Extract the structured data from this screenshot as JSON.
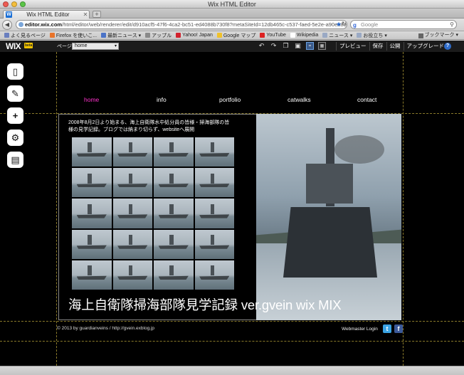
{
  "window": {
    "title": "Wix HTML Editor",
    "traffic_colors": [
      "#ee5b52",
      "#f4be3c",
      "#5bc548"
    ]
  },
  "tabs": [
    {
      "label": "Wix HTML Editor",
      "favicon": "wix-favicon"
    }
  ],
  "newtab_label": "+",
  "nav": {
    "url_host": "editor.wix.com",
    "url_path": "/html/editor/web/renderer/edit/d910acf5-47f6-4ca2-bc51-ed4088b730f8?metaSiteId=12db465c-c537-faed-5e2e-a90ee8931",
    "search_placeholder": "Google",
    "back_symbol": "◀",
    "star_symbol": "★",
    "refresh_symbol": "↻",
    "search_symbol": "⚲",
    "search_g": "g"
  },
  "bookmarks": [
    {
      "label": "よく見るページ",
      "icon_color": "#6a7fbf"
    },
    {
      "label": "Firefox を使いこ...",
      "icon_color": "#e8742a"
    },
    {
      "label": "最新ニュース ▾",
      "icon_color": "#4b73c7"
    },
    {
      "label": "アップル",
      "icon_color": "#8a8a8a"
    },
    {
      "label": "Yahoo! Japan",
      "icon_color": "#d2212d"
    },
    {
      "label": "Google マップ",
      "icon_color": "#f0c12b"
    },
    {
      "label": "YouTube",
      "icon_color": "#d22"
    },
    {
      "label": "Wikipedia",
      "icon_color": "#fff"
    },
    {
      "label": "ニュース ▾",
      "icon_color": "#9aa9c4"
    },
    {
      "label": "お役立ち ▾",
      "icon_color": "#9aa9c4"
    }
  ],
  "bookmarks_menu": "ブックマーク ▾",
  "wix_bar": {
    "logo": "WIX",
    "beta": "beta",
    "page_label": "ページ:",
    "page_value": "home",
    "caret": "▾",
    "tools": [
      "↶",
      "↷",
      "❐",
      "▣",
      "⌗",
      "▦"
    ],
    "menu": [
      "プレビュー",
      "保存",
      "公開",
      "アップグレード"
    ],
    "help": "?",
    "accent": "#2e6bc9"
  },
  "side_tools": [
    {
      "name": "pages-icon",
      "glyph": "▯"
    },
    {
      "name": "design-brush-icon",
      "glyph": "✎"
    },
    {
      "name": "add-icon",
      "glyph": "+"
    },
    {
      "name": "settings-gear-icon",
      "glyph": "⚙"
    },
    {
      "name": "app-market-icon",
      "glyph": "▤"
    }
  ],
  "site": {
    "nav": [
      {
        "label": "home",
        "color": "#ff33cc"
      },
      {
        "label": "info",
        "color": "#ffffff"
      },
      {
        "label": "portfolio",
        "color": "#ffffff"
      },
      {
        "label": "catwalks",
        "color": "#ffffff"
      },
      {
        "label": "contact",
        "color": "#ffffff"
      }
    ],
    "intro": "2008年8月2日より始まる、海上自衛隊水中処分員の皆様・掃海部隊の皆様の見学記録。ブログでは納まり切らず、websiteへ展開",
    "hero_title": "海上自衛隊掃海部隊見学記録 ver.gvein wix MIX",
    "footer_copy": "© 2013 by guardianveins / http://gvein.exblog.jp",
    "footer_login": "Webmaster Login",
    "social": [
      {
        "name": "twitter-icon",
        "glyph": "t",
        "color": "#3aa3e3"
      },
      {
        "name": "facebook-icon",
        "glyph": "f",
        "color": "#3b5998"
      }
    ]
  }
}
